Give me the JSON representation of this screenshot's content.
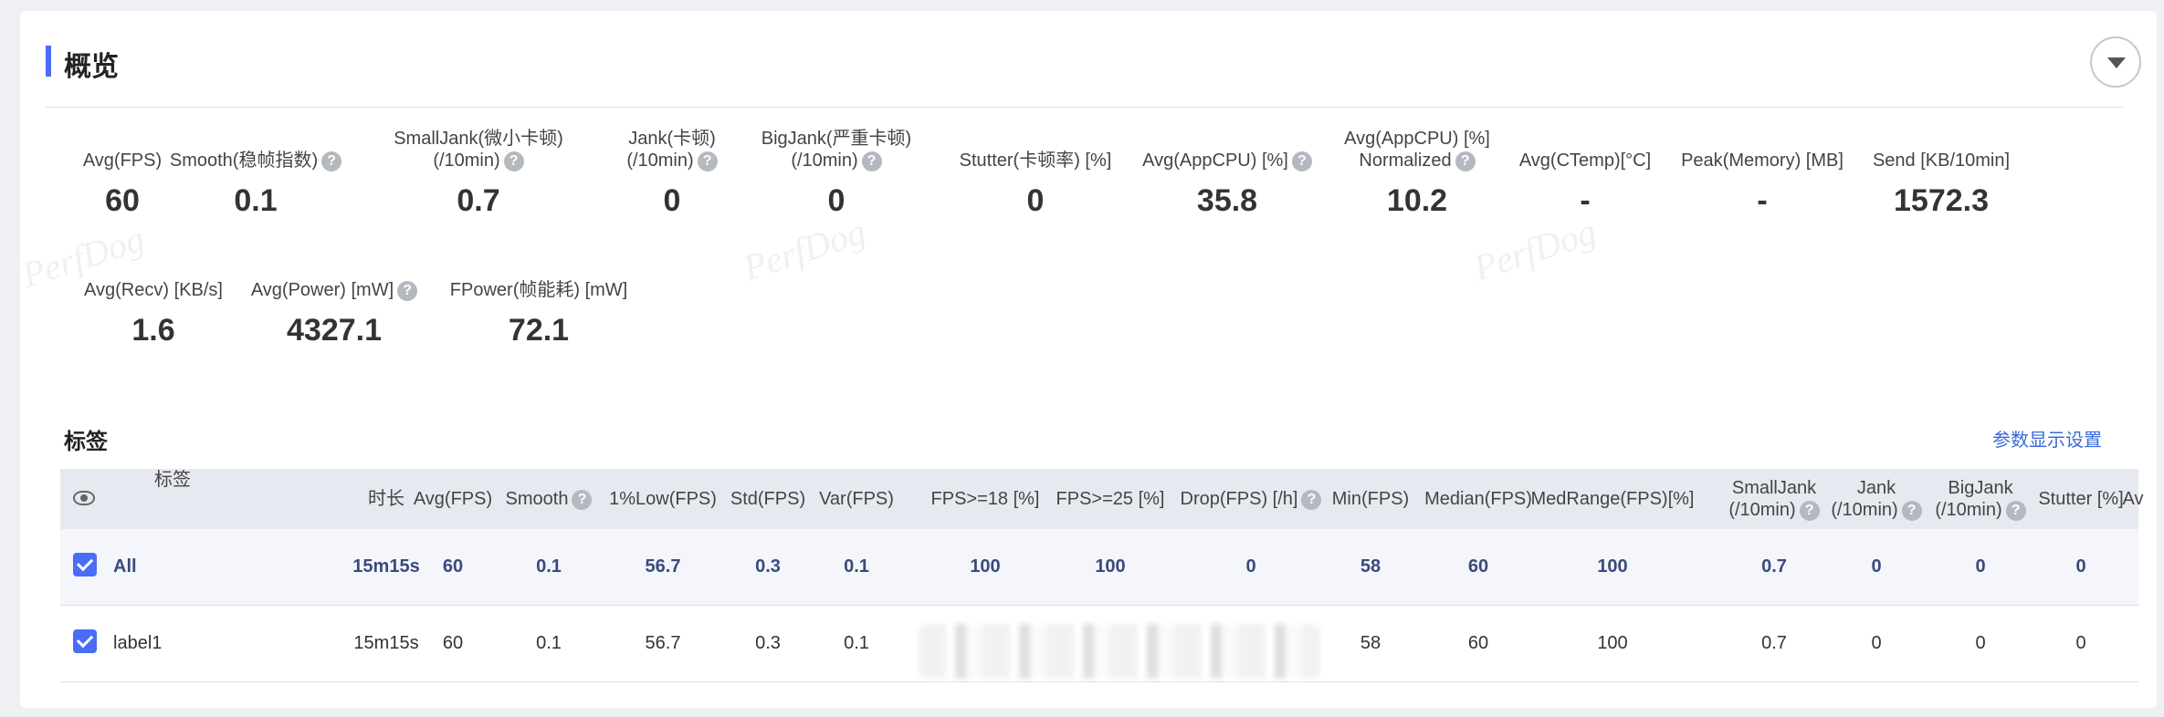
{
  "section": {
    "title": "概览"
  },
  "metrics_row1": [
    {
      "label": "Avg(FPS)",
      "value": "60",
      "help": false
    },
    {
      "label": "Smooth(稳帧指数)",
      "value": "0.1",
      "help": true
    },
    {
      "label": "SmallJank(微小卡顿)\n(/10min)",
      "value": "0.7",
      "help": true
    },
    {
      "label": "Jank(卡顿)\n(/10min)",
      "value": "0",
      "help": true
    },
    {
      "label": "BigJank(严重卡顿)\n(/10min)",
      "value": "0",
      "help": true
    },
    {
      "label": "Stutter(卡顿率) [%]",
      "value": "0",
      "help": false
    },
    {
      "label": "Avg(AppCPU) [%]",
      "value": "35.8",
      "help": true
    },
    {
      "label": "Avg(AppCPU) [%]\nNormalized",
      "value": "10.2",
      "help": true
    },
    {
      "label": "Avg(CTemp)[°C]",
      "value": "-",
      "help": false
    },
    {
      "label": "Peak(Memory) [MB]",
      "value": "-",
      "help": false
    },
    {
      "label": "Send [KB/10min]",
      "value": "1572.3",
      "help": false
    }
  ],
  "metrics_row2": [
    {
      "label": "Avg(Recv) [KB/s]",
      "value": "1.6",
      "help": false
    },
    {
      "label": "Avg(Power) [mW]",
      "value": "4327.1",
      "help": true
    },
    {
      "label": "FPower(帧能耗) [mW]",
      "value": "72.1",
      "help": false
    }
  ],
  "watermark": "PerfDog",
  "tags": {
    "title": "标签",
    "settings_link": "参数显示设置",
    "columns": [
      "标签",
      "时长",
      "Avg(FPS)",
      "Smooth",
      "1%Low(FPS)",
      "Std(FPS)",
      "Var(FPS)",
      "FPS>=18 [%]",
      "FPS>=25 [%]",
      "Drop(FPS) [/h]",
      "Min(FPS)",
      "Median(FPS)",
      "MedRange(FPS)[%]",
      "SmallJank\n(/10min)",
      "Jank\n(/10min)",
      "BigJank\n(/10min)",
      "Stutter [%]",
      "Av"
    ],
    "rows": [
      [
        "All",
        "15m15s",
        "60",
        "0.1",
        "56.7",
        "0.3",
        "0.1",
        "100",
        "100",
        "0",
        "58",
        "60",
        "100",
        "0.7",
        "0",
        "0",
        "0"
      ],
      [
        "label1",
        "15m15s",
        "60",
        "0.1",
        "56.7",
        "0.3",
        "0.1",
        "",
        "",
        "",
        "58",
        "60",
        "100",
        "0.7",
        "0",
        "0",
        "0"
      ]
    ]
  }
}
